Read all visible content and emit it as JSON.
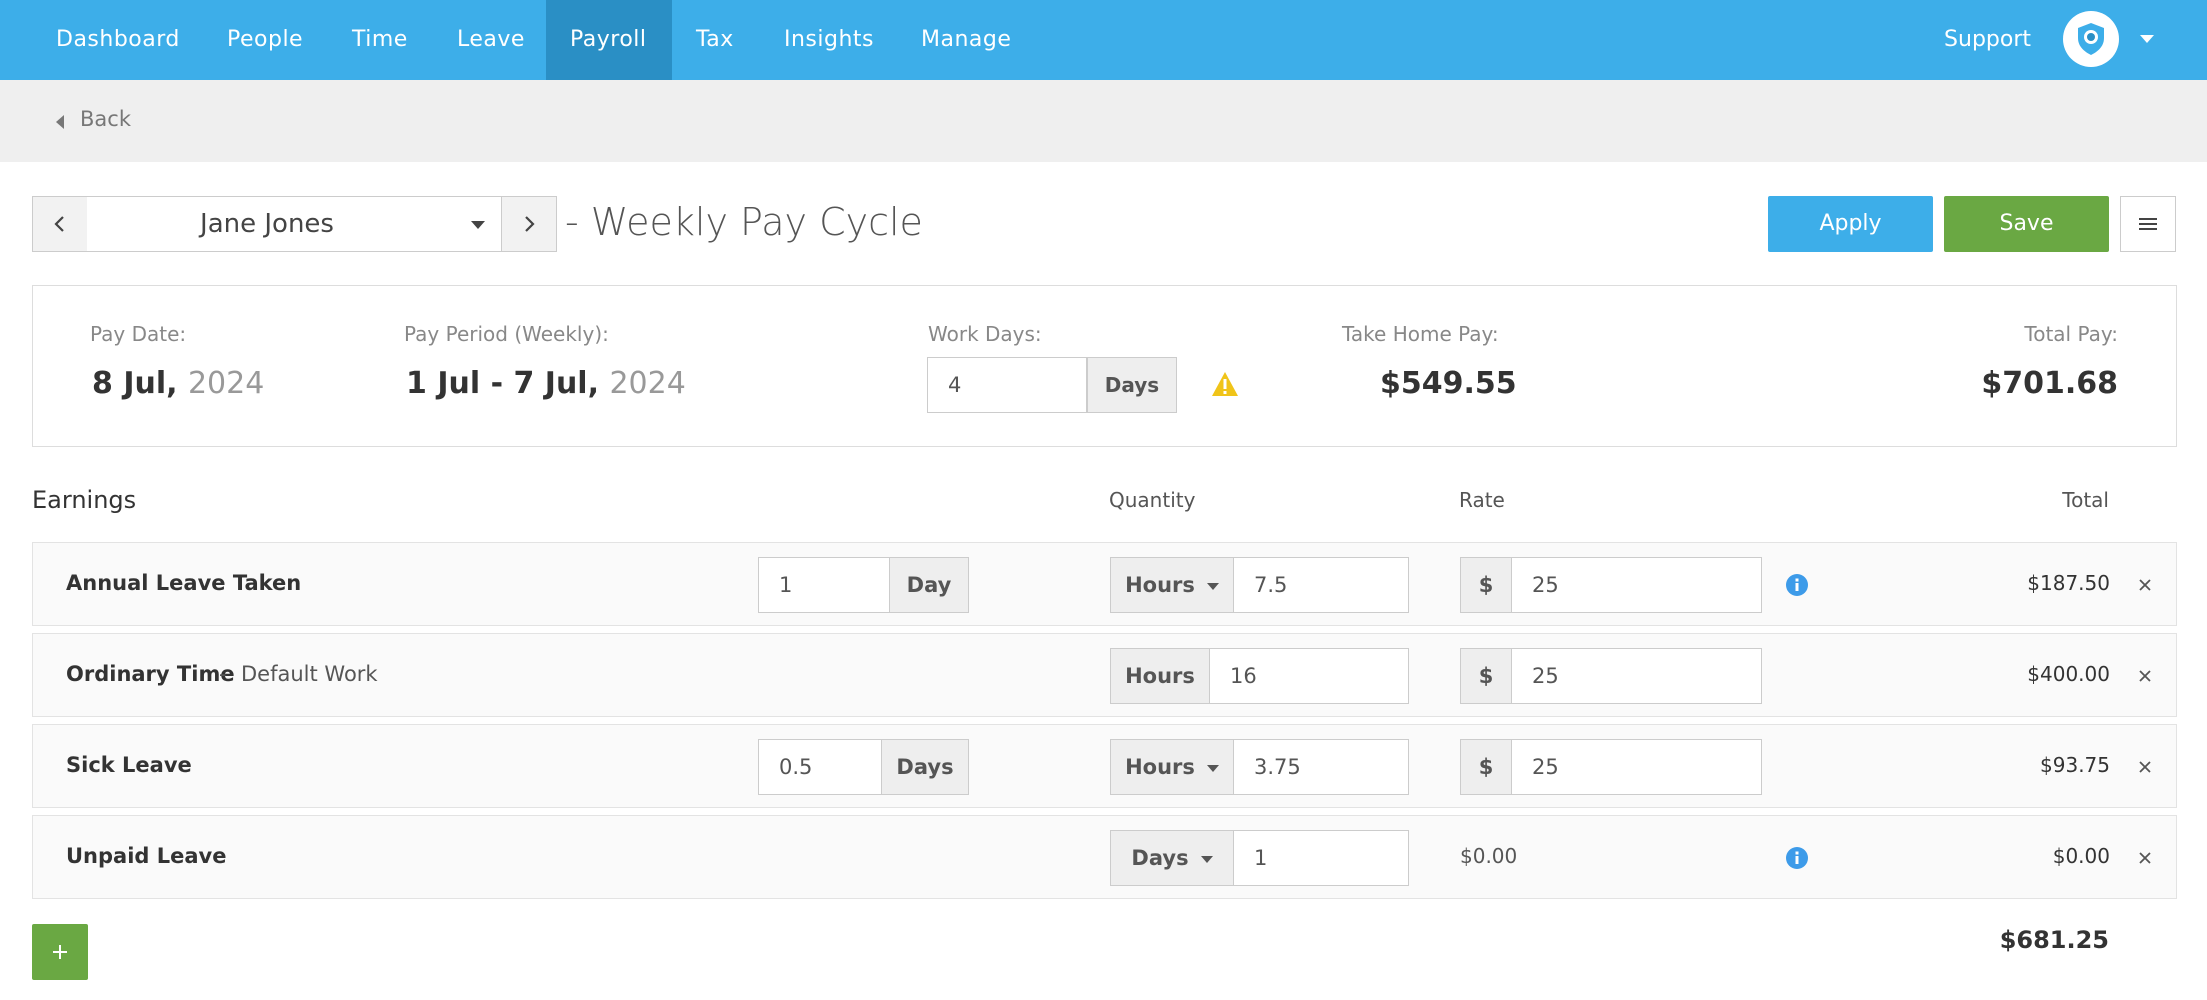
{
  "nav": {
    "items": [
      "Dashboard",
      "People",
      "Time",
      "Leave",
      "Payroll",
      "Tax",
      "Insights",
      "Manage"
    ],
    "active": "Payroll",
    "support": "Support"
  },
  "back_label": "Back",
  "header": {
    "employee": "Jane Jones",
    "cycle_title": "- Weekly Pay Cycle",
    "apply_label": "Apply",
    "save_label": "Save"
  },
  "summary": {
    "pay_date_label": "Pay Date:",
    "pay_date_main": "8 Jul, ",
    "pay_date_year": "2024",
    "pay_period_label": "Pay Period (Weekly):",
    "pay_period_main": "1 Jul - 7 Jul, ",
    "pay_period_year": "2024",
    "work_days_label": "Work Days:",
    "work_days_value": "4",
    "work_days_unit": "Days",
    "take_home_label": "Take Home Pay:",
    "take_home_value": "$549.55",
    "total_pay_label": "Total Pay:",
    "total_pay_value": "$701.68"
  },
  "earnings": {
    "title": "Earnings",
    "col_quantity": "Quantity",
    "col_rate": "Rate",
    "col_total": "Total",
    "rows": [
      {
        "name": "Annual Leave Taken",
        "leave_qty": "1",
        "leave_unit": "Day",
        "qty_unit": "Hours",
        "qty": "7.5",
        "currency": "$",
        "rate": "25",
        "total": "$187.50"
      },
      {
        "name": "Ordinary Time",
        "separator": "-",
        "sub": "Default Work",
        "qty_unit": "Hours",
        "qty": "16",
        "currency": "$",
        "rate": "25",
        "total": "$400.00"
      },
      {
        "name": "Sick Leave",
        "leave_qty": "0.5",
        "leave_unit": "Days",
        "qty_unit": "Hours",
        "qty": "3.75",
        "currency": "$",
        "rate": "25",
        "total": "$93.75"
      },
      {
        "name": "Unpaid Leave",
        "qty_unit": "Days",
        "qty": "1",
        "rate_text": "$0.00",
        "total": "$0.00"
      }
    ],
    "grand_total": "$681.25"
  },
  "colors": {
    "nav_bg": "#3daee9",
    "nav_active": "#2a8fc5",
    "save_green": "#6aa843",
    "warning": "#f0c419",
    "info": "#3d9be9"
  }
}
